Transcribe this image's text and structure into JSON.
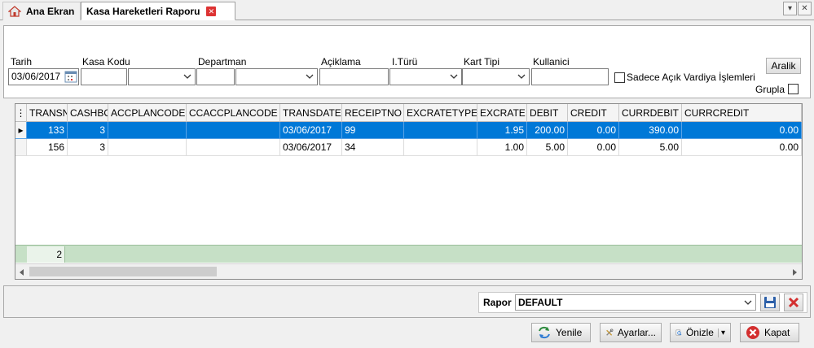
{
  "tabs": {
    "home_label": "Ana Ekran",
    "active_label": "Kasa Hareketleri Raporu"
  },
  "filters": {
    "tarih_label": "Tarih",
    "tarih_value": "03/06/2017",
    "kasa_kodu_label": "Kasa Kodu",
    "departman_label": "Departman",
    "aciklama_label": "Açiklama",
    "i_turu_label": "I.Türü",
    "kart_tipi_label": "Kart Tipi",
    "kullanici_label": "Kullanici",
    "aralik_label": "Aralik",
    "sadece_label": "Sadece Açık Vardiya İşlemleri",
    "grupla_label": "Grupla"
  },
  "grid": {
    "columns": [
      "TRANSNO",
      "CASHBOX",
      "ACCPLANCODE",
      "CCACCPLANCODE",
      "TRANSDATE",
      "RECEIPTNO",
      "EXCRATETYPE",
      "EXCRATE",
      "DEBIT",
      "CREDIT",
      "CURRDEBIT",
      "CURRCREDIT"
    ],
    "rows": [
      [
        "133",
        "3",
        "",
        "",
        "03/06/2017",
        "99",
        "",
        "1.95",
        "200.00",
        "0.00",
        "390.00",
        "0.00"
      ],
      [
        "156",
        "3",
        "",
        "",
        "03/06/2017",
        "34",
        "",
        "1.00",
        "5.00",
        "0.00",
        "5.00",
        "0.00"
      ]
    ],
    "footer_count": "2"
  },
  "report": {
    "label": "Rapor",
    "value": "DEFAULT"
  },
  "actions": {
    "yenile": "Yenile",
    "ayarlar": "Ayarlar...",
    "onizle": "Önizle",
    "kapat": "Kapat"
  },
  "colors": {
    "selection": "#0078d7",
    "footer_green": "#c6e0c6"
  }
}
